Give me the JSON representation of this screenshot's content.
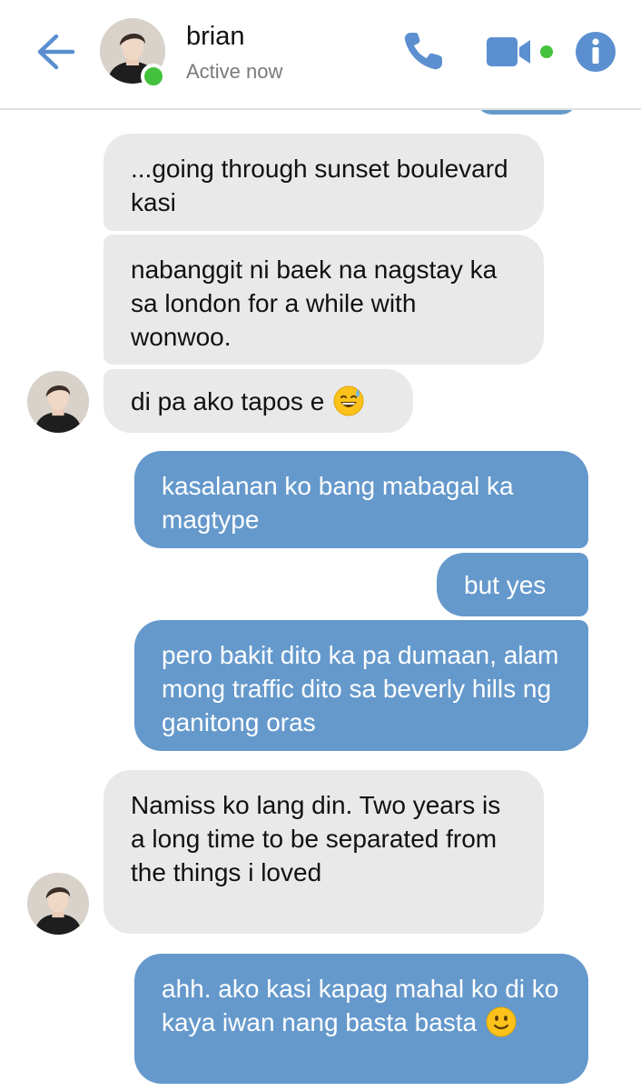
{
  "header": {
    "contact_name": "brian",
    "status": "Active now",
    "accent_color": "#5b8fd0",
    "online_color": "#44c13d"
  },
  "icons": {
    "back": "arrow-left-icon",
    "call": "phone-icon",
    "video": "video-camera-icon",
    "info": "info-icon",
    "avatar": "avatar-photo"
  },
  "colors": {
    "incoming_bubble": "#e9e9e9",
    "outgoing_bubble": "#6599cc"
  },
  "messages": [
    {
      "direction": "in",
      "text": "...going through sunset boulevard kasi"
    },
    {
      "direction": "in",
      "text": "nabanggit ni baek na nagstay ka sa london for a while with wonwoo."
    },
    {
      "direction": "in",
      "text": "di pa ako tapos e",
      "emoji": "sweat-smile-emoji"
    },
    {
      "direction": "out",
      "text": "kasalanan ko bang mabagal ka magtype"
    },
    {
      "direction": "out",
      "text": "but yes"
    },
    {
      "direction": "out",
      "text": "pero bakit dito ka pa dumaan, alam mong traffic dito sa beverly hills ng ganitong oras"
    },
    {
      "direction": "in",
      "text": "Namiss ko lang din. Two years is a long time to be separated from the things i loved"
    },
    {
      "direction": "out",
      "text": "ahh. ako kasi kapag mahal ko di ko kaya iwan nang basta basta",
      "emoji": "slight-smile-emoji"
    }
  ]
}
